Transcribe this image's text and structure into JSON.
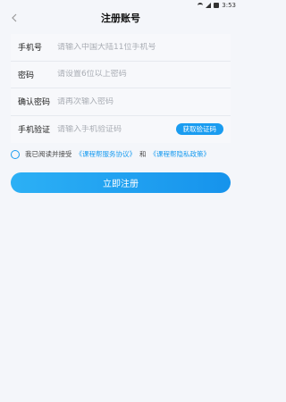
{
  "status_bar": {
    "time": "3:53"
  },
  "header": {
    "title": "注册账号"
  },
  "form": {
    "phone": {
      "label": "手机号",
      "placeholder": "请输入中国大陆11位手机号",
      "value": ""
    },
    "password": {
      "label": "密码",
      "placeholder": "请设置6位以上密码",
      "value": ""
    },
    "confirm_password": {
      "label": "确认密码",
      "placeholder": "请再次输入密码",
      "value": ""
    },
    "verify_code": {
      "label": "手机验证",
      "placeholder": "请输入手机验证码",
      "value": "",
      "button_label": "获取验证码"
    }
  },
  "agreement": {
    "prefix": "我已阅读并接受",
    "service_link": "《课程帮服务协议》",
    "and_text": "和",
    "privacy_link": "《课程帮隐私政策》",
    "checked": false
  },
  "submit": {
    "label": "立即注册"
  },
  "colors": {
    "accent": "#1a9cf0",
    "background": "#f4f6fa"
  },
  "icons": {
    "back": "chevron-left-icon",
    "wifi": "wifi-icon",
    "signal": "signal-icon",
    "battery": "battery-icon"
  }
}
